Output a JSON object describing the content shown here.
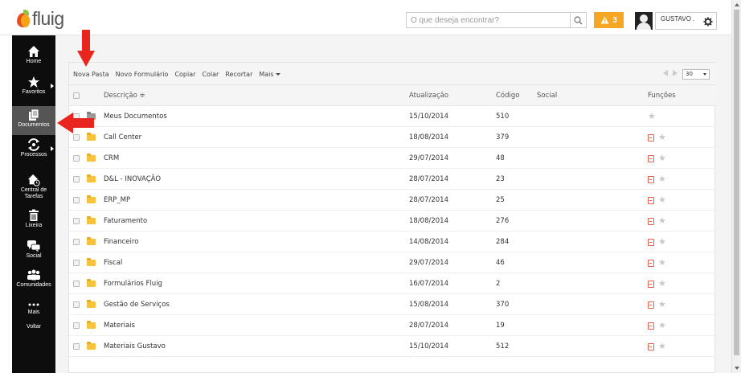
{
  "header": {
    "logo_text": "fluig",
    "search_placeholder": "O que deseja encontrar?",
    "alert_count": "3",
    "user_name": "GUSTAVO ."
  },
  "sidebar": {
    "items": [
      {
        "label": "Home",
        "icon": "home-icon"
      },
      {
        "label": "Favoritos",
        "icon": "star-icon"
      },
      {
        "label": "Documentos",
        "icon": "documents-icon"
      },
      {
        "label": "Processos",
        "icon": "processes-icon"
      },
      {
        "label": "Central de Tarefas",
        "icon": "task-center-icon"
      },
      {
        "label": "Lixeira",
        "icon": "trash-icon"
      },
      {
        "label": "Social",
        "icon": "social-icon"
      },
      {
        "label": "Comunidades",
        "icon": "communities-icon"
      },
      {
        "label": "Mais",
        "icon": "more-icon"
      },
      {
        "label": "Voltar",
        "icon": ""
      }
    ]
  },
  "toolbar": {
    "nova_pasta": "Nova Pasta",
    "novo_formulario": "Novo Formulário",
    "copiar": "Copiar",
    "colar": "Colar",
    "recortar": "Recortar",
    "mais": "Mais",
    "page_size": "30"
  },
  "table": {
    "headers": {
      "descricao": "Descrição ≑",
      "atualizacao": "Atualização",
      "codigo": "Código",
      "social": "Social",
      "funcoes": "Funções"
    },
    "rows": [
      {
        "desc": "Meus Documentos",
        "date": "15/10/2014",
        "code": "510",
        "folder": "grey",
        "funcs": "star-only"
      },
      {
        "desc": "Call Center",
        "date": "18/08/2014",
        "code": "379",
        "folder": "yellow",
        "funcs": "doc-star"
      },
      {
        "desc": "CRM",
        "date": "29/07/2014",
        "code": "48",
        "folder": "yellow",
        "funcs": "doc-star"
      },
      {
        "desc": "D&L - INOVAÇÃO",
        "date": "28/07/2014",
        "code": "23",
        "folder": "yellow",
        "funcs": "doc-star"
      },
      {
        "desc": "ERP_MP",
        "date": "28/07/2014",
        "code": "25",
        "folder": "yellow",
        "funcs": "doc-star"
      },
      {
        "desc": "Faturamento",
        "date": "18/08/2014",
        "code": "276",
        "folder": "yellow",
        "funcs": "doc-star"
      },
      {
        "desc": "Financeiro",
        "date": "14/08/2014",
        "code": "284",
        "folder": "yellow",
        "funcs": "doc-star"
      },
      {
        "desc": "Fiscal",
        "date": "29/07/2014",
        "code": "46",
        "folder": "yellow",
        "funcs": "doc-star"
      },
      {
        "desc": "Formulários Fluig",
        "date": "16/07/2014",
        "code": "2",
        "folder": "yellow",
        "funcs": "doc-star"
      },
      {
        "desc": "Gestão de Serviços",
        "date": "15/08/2014",
        "code": "370",
        "folder": "yellow",
        "funcs": "doc-star"
      },
      {
        "desc": "Materiais",
        "date": "28/07/2014",
        "code": "19",
        "folder": "yellow",
        "funcs": "doc-star"
      },
      {
        "desc": "Materiais Gustavo",
        "date": "15/10/2014",
        "code": "512",
        "folder": "yellow",
        "funcs": "doc-star"
      }
    ]
  },
  "colors": {
    "sidebar_bg": "#0d0d0d",
    "alert": "#f5a623",
    "annotation_arrow": "#e8261e",
    "folder": "#f7c33e"
  }
}
